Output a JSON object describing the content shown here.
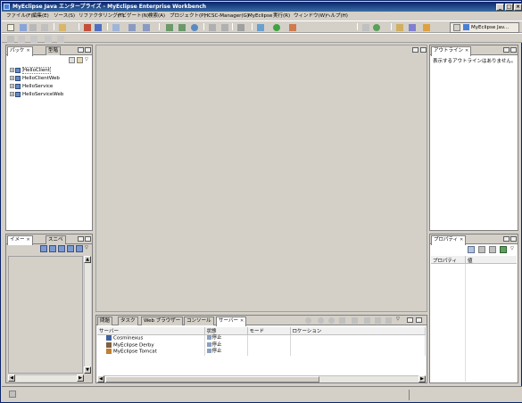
{
  "window": {
    "title": "MyEclipse Java エンタープライズ - MyEclipse Enterprise Workbench"
  },
  "menu": [
    "ファイル(F)",
    "編集(E)",
    "ソース(S)",
    "リファクタリング(T)",
    "ナビゲート(N)",
    "検索(A)",
    "プロジェクト(P)",
    "HCSC-Manager(G)",
    "MyEclipse",
    "実行(R)",
    "ウィンドウ(W)",
    "ヘルプ(H)"
  ],
  "perspective": {
    "label": "MyEclipse Jav..."
  },
  "left_top": {
    "tabs": [
      "パッケ",
      "型階"
    ],
    "projects": [
      "HelloClient",
      "HelloClientWeb",
      "HelloService",
      "HelloServiceWeb"
    ]
  },
  "left_bottom": {
    "tabs": [
      "イメー",
      "スニペ"
    ]
  },
  "outline": {
    "tab": "アウトライン",
    "message": "表示するアウトラインはありません。"
  },
  "properties": {
    "tab": "プロパティ",
    "columns": [
      "プロパティ",
      "値"
    ]
  },
  "bottom": {
    "tabs": [
      "問題",
      "タスク",
      "Web ブラウザー",
      "コンソール",
      "サーバー"
    ],
    "columns": [
      "サーバー",
      "状態",
      "モード",
      "ロケーション"
    ],
    "servers": [
      {
        "name": "Cosminexus",
        "state": "停止"
      },
      {
        "name": "MyEclipse Derby",
        "state": "停止"
      },
      {
        "name": "MyEclipse Tomcat",
        "state": "停止"
      }
    ]
  },
  "colors": {
    "titlebar": "#0a246a",
    "chrome": "#d4d0c8",
    "editor_bg": "#d4d0c8"
  }
}
